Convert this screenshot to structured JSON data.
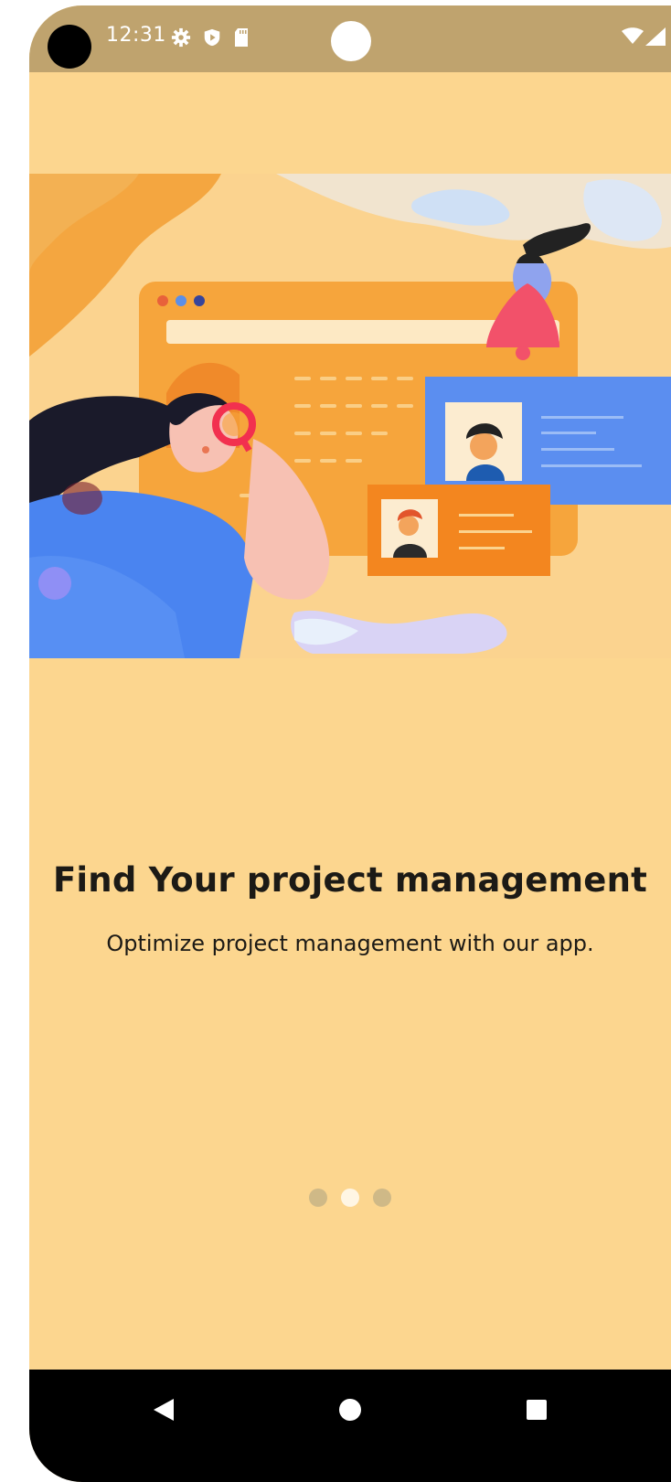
{
  "status_bar": {
    "time": "12:31",
    "icons": [
      "settings-gear-icon",
      "shield-play-icon",
      "sd-card-icon",
      "wifi-icon",
      "cell-signal-icon"
    ]
  },
  "onboarding": {
    "illustration": "project-management-illustration",
    "title": "Find Your project management",
    "subtitle": "Optimize project management with our app.",
    "pager": {
      "count": 3,
      "active_index": 1
    }
  },
  "navigation": {
    "buttons": [
      "back-icon",
      "home-icon",
      "recents-icon"
    ]
  },
  "colors": {
    "background": "#fcd68f",
    "status_bar": "#bfa36e",
    "text": "#1c1a16",
    "dot_inactive": "#cfb987",
    "dot_active": "#fff6e4"
  }
}
